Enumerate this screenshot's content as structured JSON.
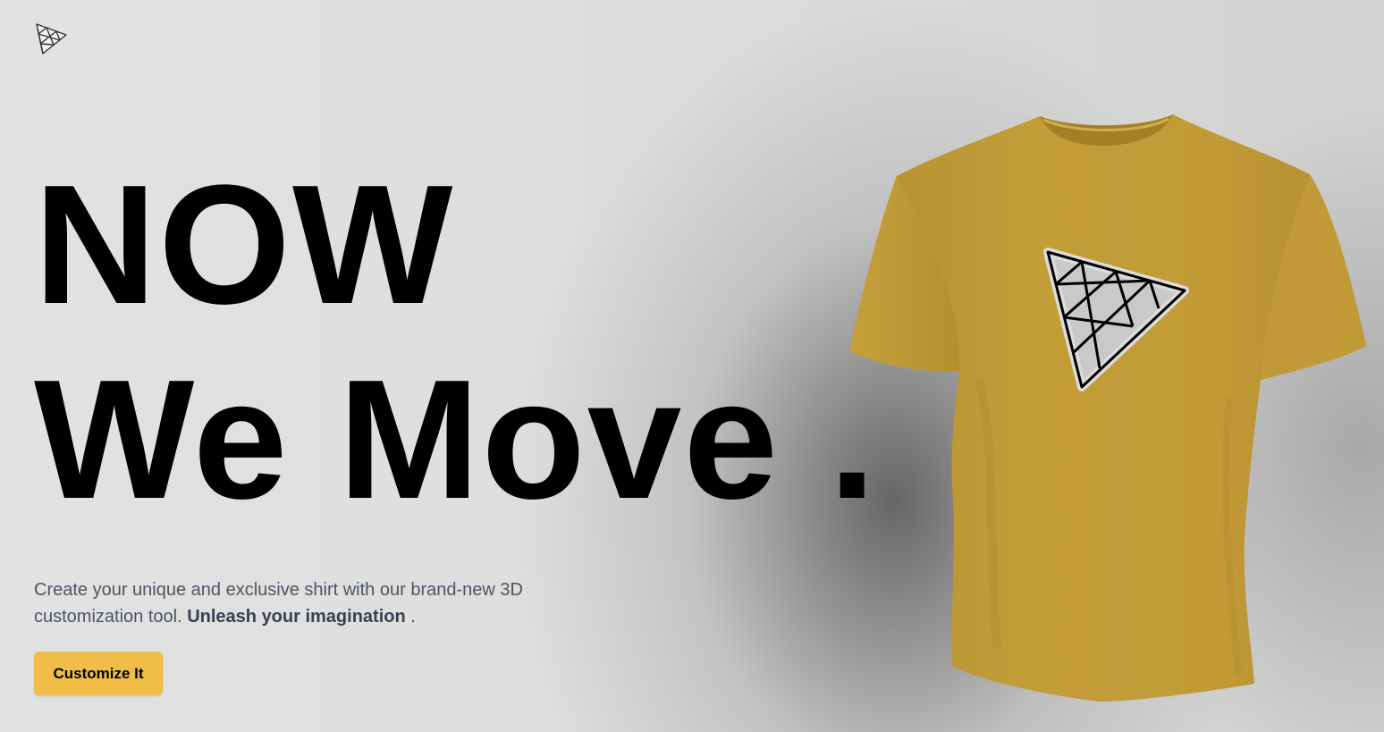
{
  "hero": {
    "headline_line1": "NOW",
    "headline_line2": "We Move .",
    "description_prefix": "Create your unique and exclusive shirt with our brand-new 3D customization tool.",
    "description_emphasis": "Unleash your imagination",
    "description_suffix": ".",
    "cta_label": "Customize It"
  },
  "product": {
    "shirt_color": "#c09a36",
    "decal_icon": "triangle-mesh-logo-icon"
  },
  "brand": {
    "logo_icon": "triangle-mesh-logo-icon"
  },
  "colors": {
    "background": "#dddddd",
    "accent": "#efbd48",
    "text": "#000000",
    "muted_text": "#4b5563"
  }
}
